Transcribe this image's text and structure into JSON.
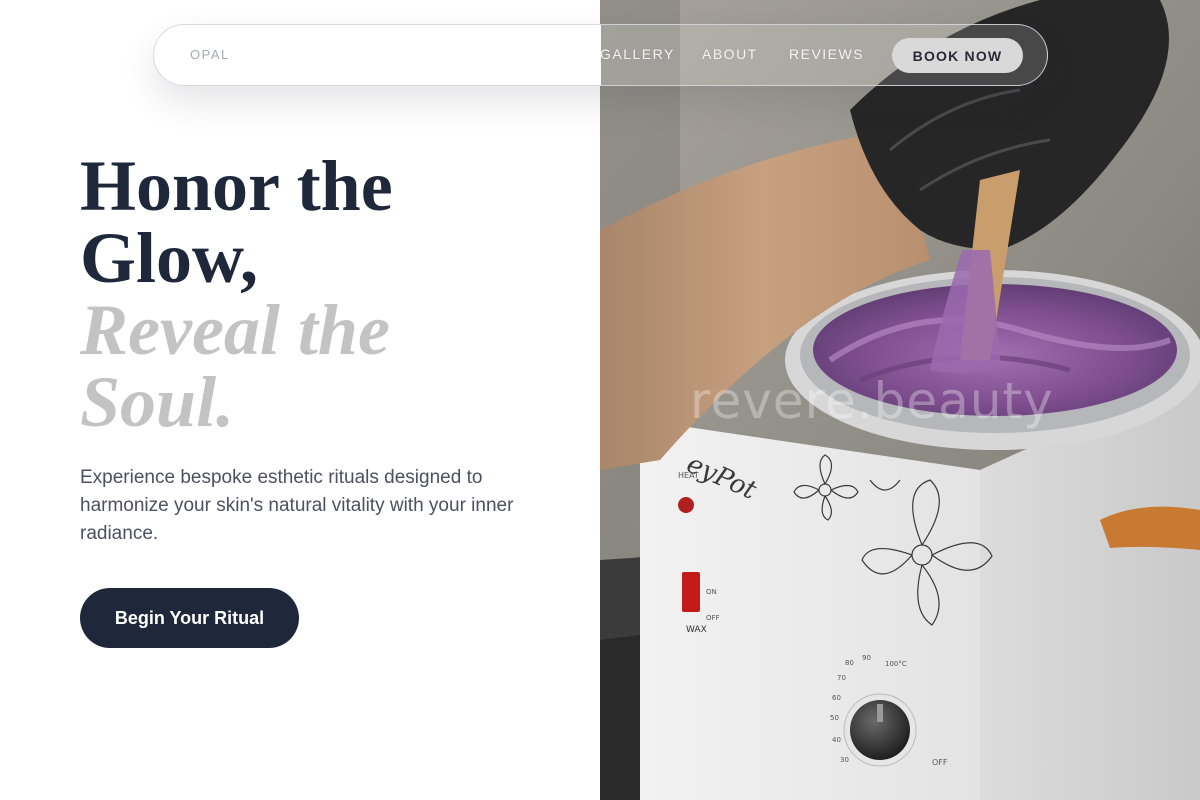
{
  "nav": {
    "logo": "OPAL",
    "links": [
      "GALLERY",
      "ABOUT",
      "REVIEWS"
    ],
    "cta": "BOOK NOW"
  },
  "hero": {
    "headline_line1": "Honor the",
    "headline_line2": "Glow,",
    "headline_italic_line1": "Reveal the",
    "headline_italic_line2": "Soul.",
    "description": "Experience bespoke esthetic rituals designed to harmonize your skin's natural vitality with your inner radiance.",
    "cta": "Begin Your Ritual"
  },
  "photo": {
    "watermark": "revere.beauty",
    "device_labels": {
      "brand": "eyPot",
      "heat": "HEAT",
      "wax": "WAX",
      "on": "ON",
      "off": "OFF",
      "dial_off": "OFF",
      "dial_ticks": [
        "30",
        "40",
        "50",
        "60",
        "70",
        "80",
        "90",
        "100°C"
      ]
    }
  },
  "colors": {
    "navy": "#1f283a",
    "muted_italic": "#c3c3c3",
    "body_text": "#4b5160",
    "wax_purple": "#8a5a9a",
    "handle_orange": "#c97a32"
  }
}
